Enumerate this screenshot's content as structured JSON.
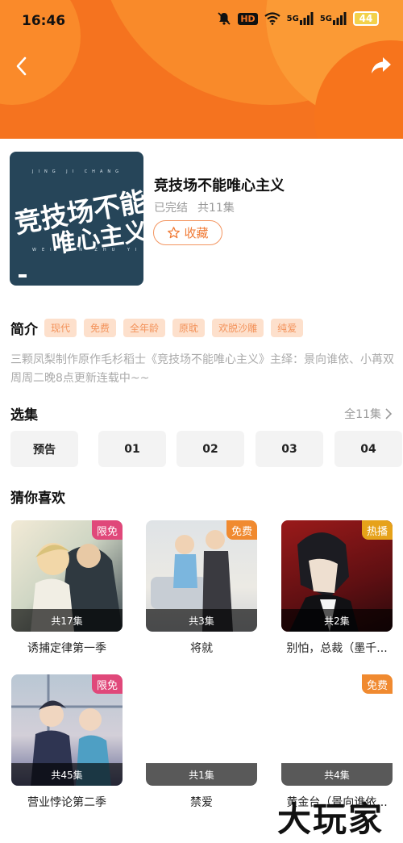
{
  "status_bar": {
    "time": "16:46",
    "battery": "44",
    "network_label": "5G",
    "hd_label": "HD"
  },
  "header": {
    "back_icon": "back-arrow-icon",
    "share_icon": "share-icon"
  },
  "colors": {
    "header_orange": "#f5731f",
    "accent": "#f07a35",
    "tag_bg": "#fde0cc",
    "tag_text": "#f3925a"
  },
  "drama": {
    "title": "竞技场不能唯心主义",
    "status": "已完结",
    "episode_count": "共11集",
    "favorite_label": "收藏",
    "cover": {
      "calligraphy_line1": "竞技场不能",
      "calligraphy_line2": "唯心主义",
      "pinyin_top": "JING JI CHANG",
      "pinyin_bottom": "WEI XIN ZHU YI"
    }
  },
  "intro": {
    "title": "简介",
    "tags": [
      "现代",
      "免费",
      "全年龄",
      "原耽",
      "欢脱沙雕",
      "纯爱"
    ],
    "description": "三颗凤梨制作原作毛杉稻士《竞技场不能唯心主义》主绎：景向谁依、小苒双周周二晚8点更新连载中~~"
  },
  "episodes": {
    "title": "选集",
    "all_label": "全11集",
    "items": [
      "预告",
      "01",
      "02",
      "03",
      "04"
    ]
  },
  "recommendations": {
    "title": "猜你喜欢",
    "items": [
      {
        "name": "诱捕定律第一季",
        "count": "共17集",
        "badge": "限免",
        "badge_color": "#e0487a"
      },
      {
        "name": "将就",
        "count": "共3集",
        "badge": "免费",
        "badge_color": "#f08a30"
      },
      {
        "name": "别怕，总裁（墨千...",
        "count": "共2集",
        "badge": "热播",
        "badge_color": "#e6a21a"
      },
      {
        "name": "营业悖论第二季",
        "count": "共45集",
        "badge": "限免",
        "badge_color": "#e0487a"
      },
      {
        "name": "禁爱",
        "count": "共1集",
        "badge": "",
        "badge_color": ""
      },
      {
        "name": "黄金台（景向谁依...",
        "count": "共4集",
        "badge": "免费",
        "badge_color": "#f08a30"
      }
    ]
  },
  "watermark": "大玩家"
}
